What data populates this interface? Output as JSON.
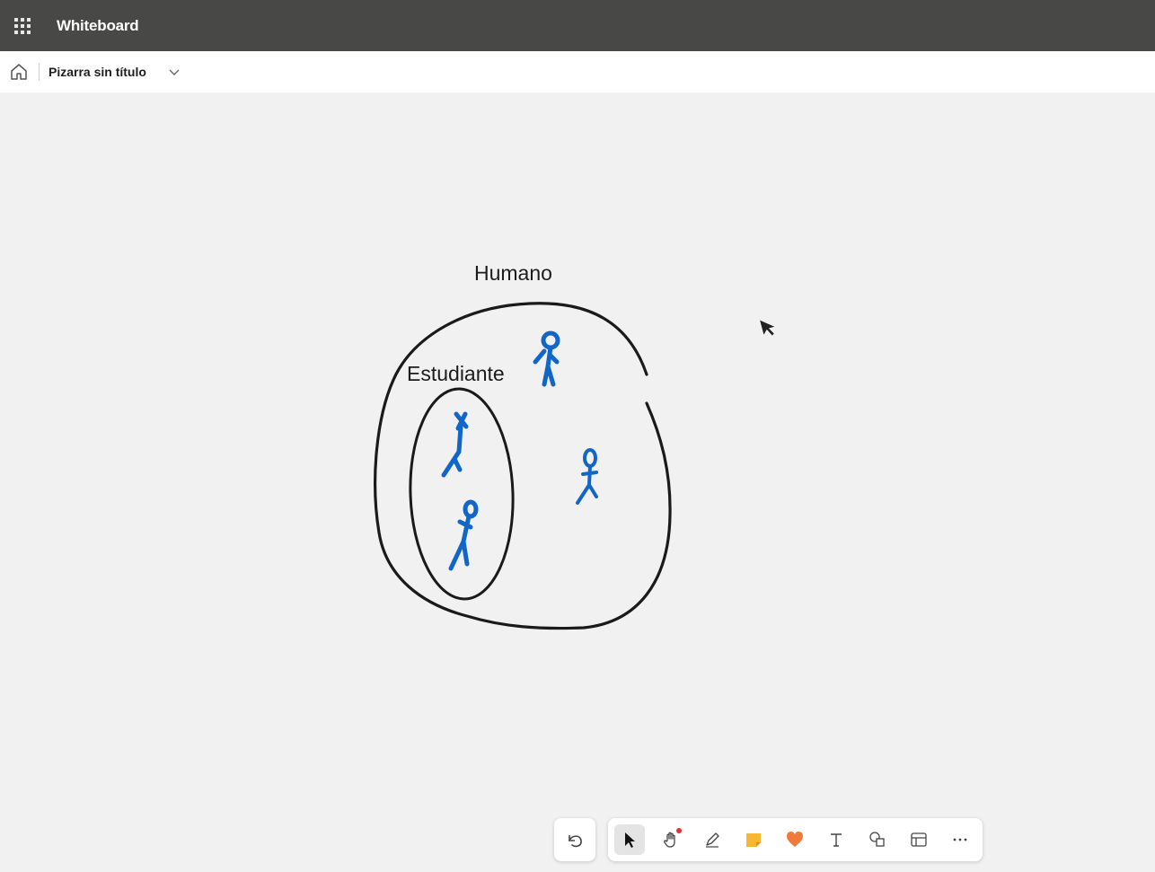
{
  "app_bar": {
    "title": "Whiteboard",
    "waffle_icon": "app-launcher-icon",
    "background": "#484846"
  },
  "doc_bar": {
    "home_icon": "home-icon",
    "board_title": "Pizarra sin título",
    "chevron_icon": "chevron-down-icon"
  },
  "canvas": {
    "background": "#f1f1f1",
    "labels": {
      "outer": "Humano",
      "inner": "Estudiante"
    },
    "ink_colors": {
      "outline": "#1a1a1a",
      "figures": "#1266c8"
    },
    "figure_count_inner": 2,
    "figure_count_outer_only": 2
  },
  "toolbar": {
    "undo_icon": "undo-icon",
    "tools": [
      {
        "name": "select",
        "icon": "pointer-icon",
        "active": true
      },
      {
        "name": "hand",
        "icon": "hand-icon",
        "active": false,
        "notification": true
      },
      {
        "name": "pen",
        "icon": "pen-icon",
        "active": false
      },
      {
        "name": "sticky-note",
        "icon": "sticky-note-icon",
        "active": false
      },
      {
        "name": "reaction",
        "icon": "heart-icon",
        "active": false
      },
      {
        "name": "text",
        "icon": "text-icon",
        "active": false
      },
      {
        "name": "shapes",
        "icon": "shapes-icon",
        "active": false
      },
      {
        "name": "templates",
        "icon": "template-icon",
        "active": false
      },
      {
        "name": "more",
        "icon": "more-icon",
        "active": false
      }
    ],
    "accent_sticky": "#f7b731",
    "accent_heart": "#f07a3c"
  }
}
